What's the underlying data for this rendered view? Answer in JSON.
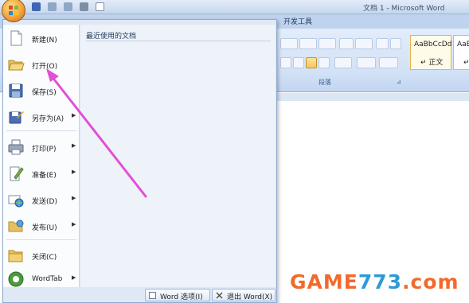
{
  "window": {
    "title": "文档 1 - Microsoft Word"
  },
  "ribbon": {
    "visible_tab": "开发工具",
    "paragraph_group_label": "段落",
    "dialog_launcher_glyph": "⊿",
    "styles": [
      {
        "sample": "AaBbCcDd",
        "name": "↵ 正文",
        "selected": true
      },
      {
        "sample": "AaBl",
        "name": "↵ 无",
        "selected": false
      }
    ]
  },
  "office_menu": {
    "recent_title": "最近使用的文档",
    "items": [
      {
        "label": "新建(N)",
        "icon": "new-document-icon",
        "submenu": false
      },
      {
        "label": "打开(O)",
        "icon": "open-folder-icon",
        "submenu": false
      },
      {
        "label": "保存(S)",
        "icon": "save-disk-icon",
        "submenu": false
      },
      {
        "label": "另存为(A)",
        "icon": "save-as-icon",
        "submenu": true
      },
      {
        "label": "打印(P)",
        "icon": "printer-icon",
        "submenu": true
      },
      {
        "label": "准备(E)",
        "icon": "prepare-pencil-icon",
        "submenu": true
      },
      {
        "label": "发送(D)",
        "icon": "send-globe-icon",
        "submenu": true
      },
      {
        "label": "发布(U)",
        "icon": "publish-folder-icon",
        "submenu": true
      },
      {
        "label": "关闭(C)",
        "icon": "close-folder-icon",
        "submenu": false
      },
      {
        "label": "WordTab",
        "icon": "wordtab-icon",
        "submenu": true
      }
    ],
    "options_button": "Word 选项(I)",
    "exit_button": "退出 Word(X)"
  },
  "watermark": {
    "part1": "GAME",
    "part2": "773",
    "part3": ".com"
  },
  "colors": {
    "annotation_arrow": "#e24fd8",
    "ribbon": "#d2e1f6",
    "menu_background": "#dfe8f5"
  }
}
